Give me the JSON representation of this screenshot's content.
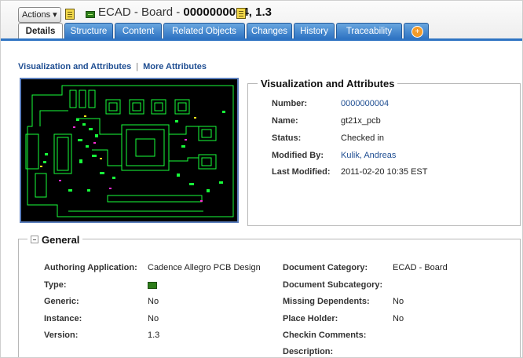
{
  "header": {
    "actions_label": "Actions ▾",
    "title_prefix": "ECAD - Board - ",
    "title_number": "0000000004, 1.3"
  },
  "tabs": [
    "Details",
    "Structure",
    "Content",
    "Related Objects",
    "Changes",
    "History",
    "Traceability"
  ],
  "sublinks": {
    "visualization": "Visualization and Attributes",
    "more": "More Attributes"
  },
  "visualization": {
    "title": "Visualization and Attributes",
    "rows": [
      {
        "label": "Number:",
        "value": "0000000004"
      },
      {
        "label": "Name:",
        "value": "gt21x_pcb"
      },
      {
        "label": "Status:",
        "value": "Checked in"
      },
      {
        "label": "Modified By:",
        "value": "Kulik, Andreas"
      },
      {
        "label": "Last Modified:",
        "value": "2011-02-20 10:35 EST"
      }
    ]
  },
  "general": {
    "title": "General",
    "left": [
      {
        "label": "Authoring Application:",
        "value": "Cadence Allegro PCB Design"
      },
      {
        "label": "Type:",
        "value": ""
      },
      {
        "label": "Generic:",
        "value": "No"
      },
      {
        "label": "Instance:",
        "value": "No"
      },
      {
        "label": "Version:",
        "value": "1.3"
      }
    ],
    "right": [
      {
        "label": "Document Category:",
        "value": "ECAD - Board"
      },
      {
        "label": "Document Subcategory:",
        "value": ""
      },
      {
        "label": "Missing Dependents:",
        "value": "No"
      },
      {
        "label": "Place Holder:",
        "value": "No"
      },
      {
        "label": "Checkin Comments:",
        "value": ""
      },
      {
        "label": "Description:",
        "value": ""
      }
    ]
  },
  "colors": {
    "tab_blue": "#2f74c3",
    "link_blue": "#1f4e92",
    "pcb_green": "#17ff3a",
    "pcb_background": "#000000"
  }
}
